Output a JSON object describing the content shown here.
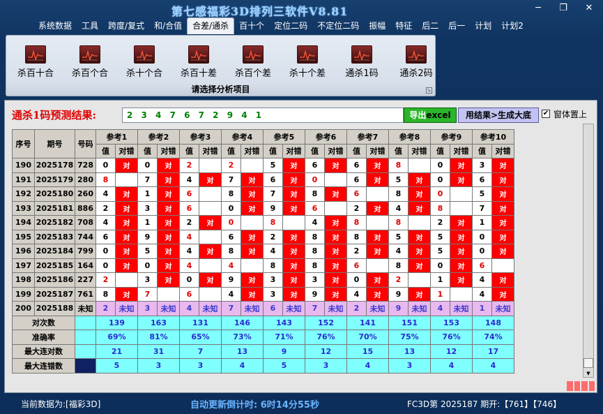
{
  "app": {
    "title": "第七感福彩3D排列三软件V8.81"
  },
  "window_controls": {
    "minimize": "─",
    "restore": "❐",
    "close": "✕"
  },
  "menu": [
    "系统数据",
    "工具",
    "跨度/复式",
    "和/合值",
    "合差/通杀",
    "百十个",
    "定位二码",
    "不定位二码",
    "振幅",
    "特征",
    "后二",
    "后一",
    "计划",
    "计划2"
  ],
  "menu_active_index": 4,
  "ribbon": {
    "buttons": [
      "杀百十合",
      "杀百个合",
      "杀十个合",
      "杀百十差",
      "杀百个差",
      "杀十个差",
      "通杀1码",
      "通杀2码"
    ],
    "icon": "chart-icon",
    "caption": "请选择分析项目"
  },
  "prediction": {
    "label": "通杀1码预测结果:",
    "value": "2 3 4 7 6 7 2 9 4 1",
    "export_label": "导出",
    "export_suffix": "excel",
    "generate_label": "用结果>生成大底",
    "pin_label": "窗体置上",
    "pin_checked": true
  },
  "table": {
    "headers": {
      "seq": "序号",
      "period": "期号",
      "number": "号码"
    },
    "refs": [
      "参考1",
      "参考2",
      "参考3",
      "参考4",
      "参考5",
      "参考6",
      "参考7",
      "参考8",
      "参考9",
      "参考10"
    ],
    "subheaders": {
      "value": "值",
      "hit": "对错"
    },
    "hit_text": "对",
    "rows": [
      {
        "seq": "190",
        "period": "2025178",
        "number": "728",
        "vals": [
          "0",
          "0",
          "2",
          "2",
          "5",
          "6",
          "6",
          "8",
          "0",
          "3"
        ],
        "hits": [
          1,
          1,
          0,
          0,
          1,
          1,
          1,
          0,
          1,
          1
        ]
      },
      {
        "seq": "191",
        "period": "2025179",
        "number": "280",
        "vals": [
          "8",
          "7",
          "4",
          "7",
          "6",
          "0",
          "6",
          "5",
          "0",
          "6"
        ],
        "hits": [
          0,
          1,
          1,
          1,
          1,
          0,
          1,
          1,
          1,
          1
        ]
      },
      {
        "seq": "192",
        "period": "2025180",
        "number": "260",
        "vals": [
          "4",
          "1",
          "6",
          "8",
          "7",
          "8",
          "6",
          "8",
          "0",
          "5"
        ],
        "hits": [
          1,
          1,
          0,
          1,
          1,
          1,
          0,
          1,
          0,
          1
        ]
      },
      {
        "seq": "193",
        "period": "2025181",
        "number": "886",
        "vals": [
          "2",
          "3",
          "6",
          "0",
          "9",
          "6",
          "2",
          "4",
          "8",
          "7"
        ],
        "hits": [
          1,
          1,
          0,
          1,
          1,
          0,
          1,
          1,
          0,
          1
        ]
      },
      {
        "seq": "194",
        "period": "2025182",
        "number": "708",
        "vals": [
          "4",
          "1",
          "2",
          "0",
          "8",
          "4",
          "8",
          "8",
          "2",
          "1"
        ],
        "hits": [
          1,
          1,
          1,
          0,
          0,
          1,
          0,
          0,
          1,
          1
        ]
      },
      {
        "seq": "195",
        "period": "2025183",
        "number": "744",
        "vals": [
          "6",
          "9",
          "4",
          "6",
          "2",
          "8",
          "8",
          "5",
          "5",
          "0"
        ],
        "hits": [
          1,
          1,
          0,
          1,
          1,
          1,
          1,
          1,
          1,
          1
        ]
      },
      {
        "seq": "196",
        "period": "2025184",
        "number": "799",
        "vals": [
          "0",
          "5",
          "4",
          "8",
          "4",
          "8",
          "2",
          "4",
          "5",
          "0"
        ],
        "hits": [
          1,
          1,
          1,
          1,
          1,
          1,
          1,
          1,
          1,
          1
        ]
      },
      {
        "seq": "197",
        "period": "2025185",
        "number": "164",
        "vals": [
          "0",
          "0",
          "4",
          "4",
          "8",
          "8",
          "6",
          "8",
          "0",
          "6"
        ],
        "hits": [
          1,
          1,
          0,
          0,
          1,
          1,
          0,
          1,
          1,
          0
        ]
      },
      {
        "seq": "198",
        "period": "2025186",
        "number": "227",
        "vals": [
          "2",
          "3",
          "0",
          "9",
          "3",
          "3",
          "0",
          "2",
          "1",
          "4"
        ],
        "hits": [
          0,
          1,
          1,
          1,
          1,
          1,
          1,
          0,
          1,
          1
        ]
      },
      {
        "seq": "199",
        "period": "2025187",
        "number": "761",
        "vals": [
          "8",
          "7",
          "6",
          "4",
          "3",
          "9",
          "4",
          "9",
          "1",
          "4"
        ],
        "hits": [
          1,
          0,
          0,
          1,
          1,
          1,
          1,
          1,
          0,
          1
        ]
      }
    ],
    "unknown_row": {
      "seq": "200",
      "period": "2025188",
      "number": "未知",
      "vals": [
        "2",
        "3",
        "4",
        "7",
        "6",
        "7",
        "2",
        "9",
        "4",
        "1"
      ],
      "hit_text": "未知"
    },
    "summary": [
      {
        "label": "对次数",
        "vals": [
          "139",
          "163",
          "131",
          "146",
          "143",
          "152",
          "141",
          "151",
          "153",
          "148"
        ]
      },
      {
        "label": "准确率",
        "vals": [
          "69%",
          "81%",
          "65%",
          "73%",
          "71%",
          "76%",
          "70%",
          "75%",
          "76%",
          "74%"
        ]
      },
      {
        "label": "最大连对数",
        "vals": [
          "21",
          "31",
          "7",
          "13",
          "9",
          "12",
          "15",
          "13",
          "12",
          "17"
        ]
      },
      {
        "label": "最大连错数",
        "vals": [
          "5",
          "3",
          "3",
          "4",
          "5",
          "3",
          "4",
          "3",
          "4",
          "4"
        ]
      }
    ]
  },
  "status": {
    "current_data": "当前数据为:[福彩3D]",
    "countdown": "自动更新倒计时: 6时14分55秒",
    "fc_info": "FC3D第 2025187 期开:【761】【746】"
  }
}
